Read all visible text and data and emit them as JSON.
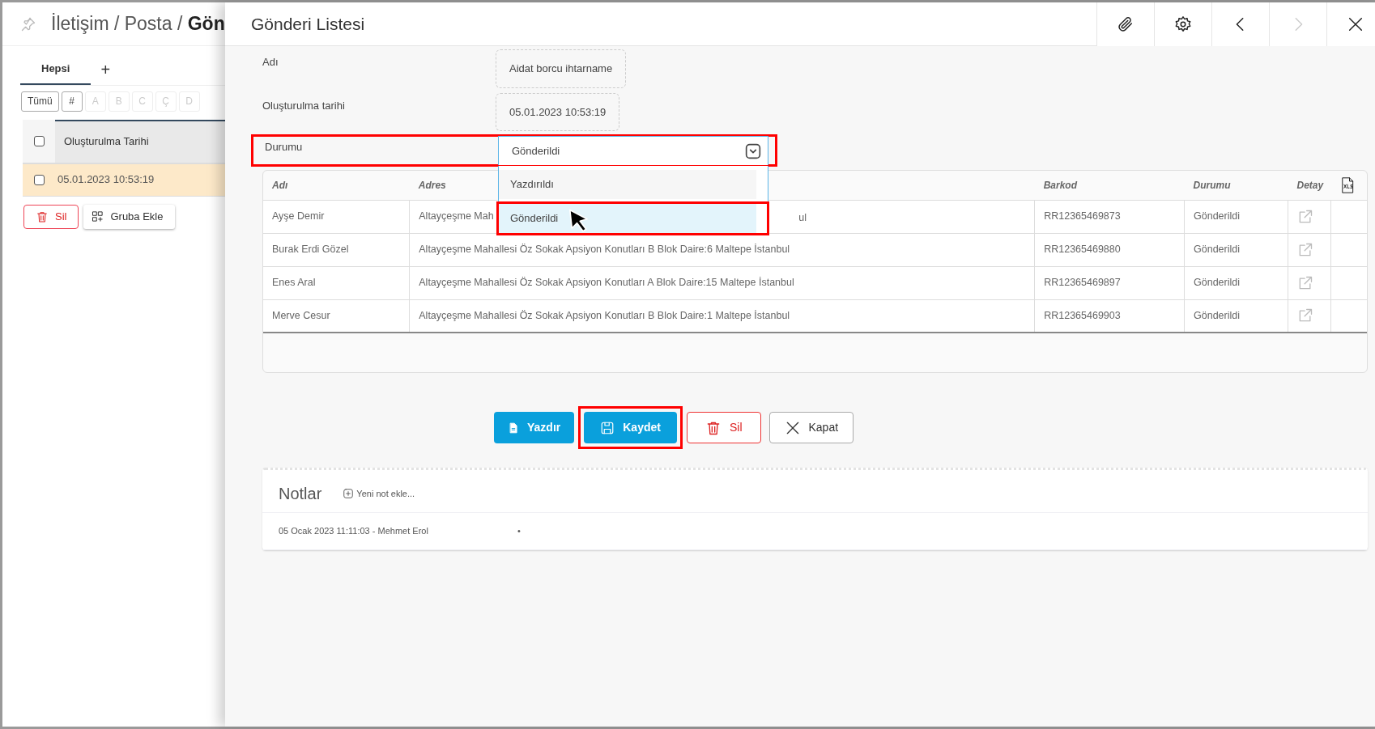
{
  "breadcrumb": {
    "path": "İletişim / Posta /",
    "current": "Gön"
  },
  "left_tabs": [
    {
      "label": "Hepsi",
      "selected": true
    },
    {
      "label": "+",
      "selected": false
    }
  ],
  "letter_filter": [
    {
      "label": "Tümü",
      "disabled": false
    },
    {
      "label": "#",
      "disabled": false
    },
    {
      "label": "A",
      "disabled": true
    },
    {
      "label": "B",
      "disabled": true
    },
    {
      "label": "C",
      "disabled": true
    },
    {
      "label": "Ç",
      "disabled": true
    },
    {
      "label": "D",
      "disabled": true
    }
  ],
  "list_table": {
    "all_checked": false,
    "columns": [
      "Oluşturulma Tarihi"
    ],
    "rows": [
      {
        "cells": [
          "05.01.2023 10:53:19"
        ],
        "selected": true,
        "checked": false
      }
    ]
  },
  "list_actions": [
    {
      "kind": "delete",
      "label": "Sil"
    },
    {
      "kind": "group",
      "label": "Gruba Ekle"
    }
  ],
  "panel": {
    "title": "Gönderi Listesi",
    "toolbar": [
      {
        "kind": "attach",
        "disabled": false
      },
      {
        "kind": "settings",
        "disabled": false
      },
      {
        "kind": "prev",
        "disabled": false
      },
      {
        "kind": "next",
        "disabled": true
      },
      {
        "kind": "close",
        "disabled": false
      }
    ]
  },
  "form": {
    "fields": [
      {
        "label": "Adı",
        "kind": "readonly",
        "value": "Aidat borcu ihtarname"
      },
      {
        "label": "Oluşturulma tarihi",
        "kind": "readonly",
        "value": "05.01.2023 10:53:19"
      },
      {
        "label": "Durumu",
        "kind": "select",
        "value": "Gönderildi",
        "expanded": true,
        "highlighted": true,
        "options": [
          {
            "label": "Yazdırıldı",
            "selected": false,
            "highlighted": false
          },
          {
            "label": "Gönderildi",
            "selected": true,
            "highlighted": true
          }
        ]
      }
    ]
  },
  "table": {
    "columns": [
      "Adı",
      "Adres",
      "Barkod",
      "Durumu",
      "Detay"
    ],
    "rows": [
      {
        "name": "Ayşe Demir",
        "address": "Altayçeşme Mah",
        "address_tail": "ul",
        "barcode": "RR12365469873",
        "status": "Gönderildi"
      },
      {
        "name": "Burak Erdi Gözel",
        "address": "Altayçeşme Mahallesi Öz Sokak Apsiyon Konutları B Blok Daire:6 Maltepe İstanbul",
        "barcode": "RR12365469880",
        "status": "Gönderildi"
      },
      {
        "name": "Enes Aral",
        "address": "Altayçeşme Mahallesi Öz Sokak Apsiyon Konutları A Blok Daire:15 Maltepe İstanbul",
        "barcode": "RR12365469897",
        "status": "Gönderildi"
      },
      {
        "name": "Merve Cesur",
        "address": "Altayçeşme Mahallesi Öz Sokak Apsiyon Konutları B Blok Daire:1 Maltepe İstanbul",
        "barcode": "RR12365469903",
        "status": "Gönderildi"
      }
    ]
  },
  "actions": [
    {
      "kind": "print",
      "label": "Yazdır",
      "highlighted": false
    },
    {
      "kind": "save",
      "label": "Kaydet",
      "highlighted": true
    },
    {
      "kind": "delete",
      "label": "Sil",
      "highlighted": false
    },
    {
      "kind": "close",
      "label": "Kapat",
      "highlighted": false
    }
  ],
  "notes": {
    "title": "Notlar",
    "add_label": "Yeni not ekle...",
    "items": [
      {
        "meta": "05 Ocak 2023 11:11:03 - Mehmet Erol",
        "text": "•"
      }
    ]
  }
}
